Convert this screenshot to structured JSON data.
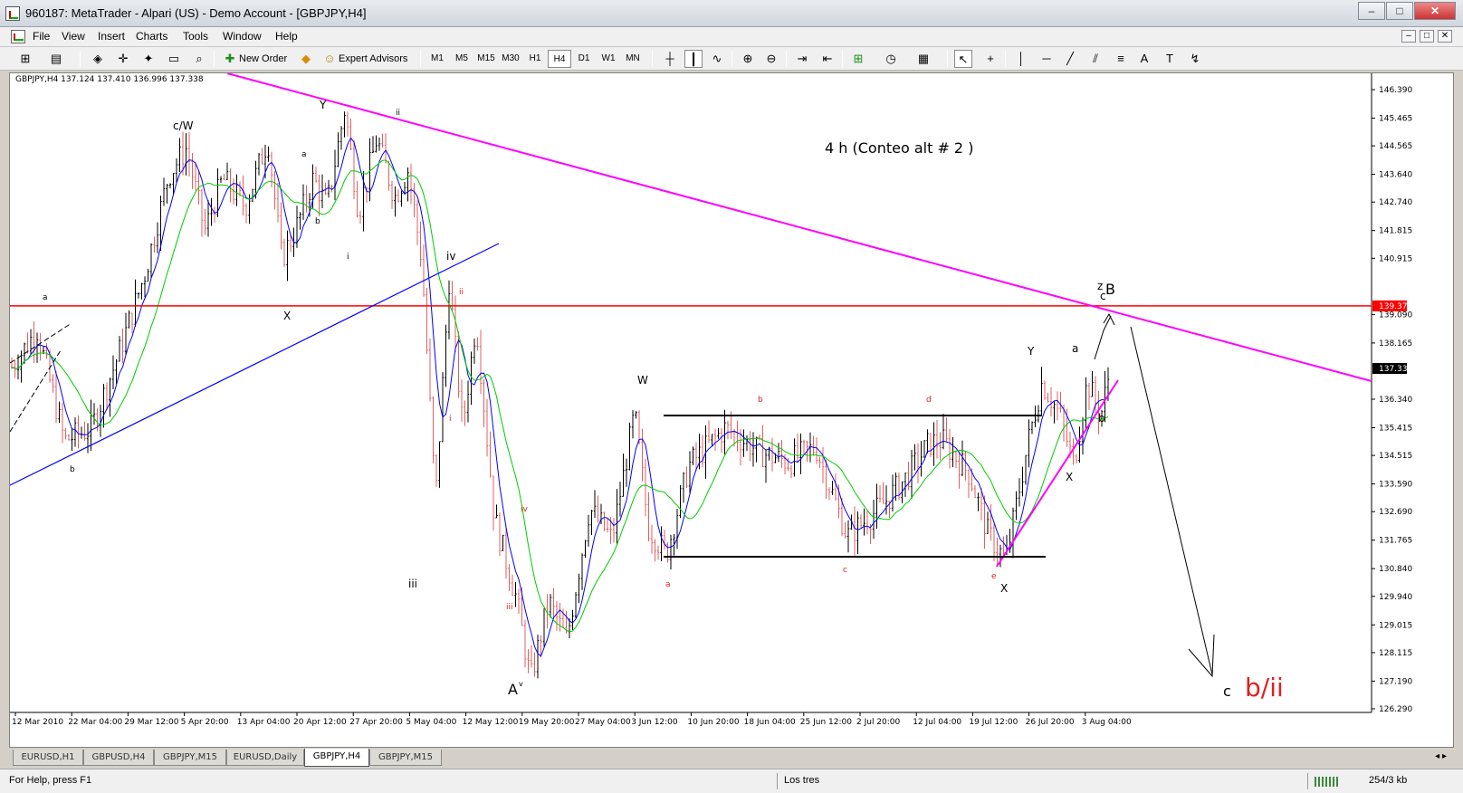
{
  "window": {
    "title": "960187: MetaTrader - Alpari (US) - Demo Account - [GBPJPY,H4]",
    "minimize": "–",
    "maximize": "□",
    "close": "✕"
  },
  "menu": {
    "items": [
      "File",
      "View",
      "Insert",
      "Charts",
      "Tools",
      "Window",
      "Help"
    ],
    "mdi_controls": [
      "–",
      "□",
      "✕"
    ]
  },
  "toolbar": {
    "new_order": "New Order",
    "expert_advisors": "Expert Advisors",
    "timeframes": [
      "M1",
      "M5",
      "M15",
      "M30",
      "H1",
      "H4",
      "D1",
      "W1",
      "MN"
    ],
    "active_timeframe": "H4",
    "icons": [
      "new-chart-icon",
      "profiles-icon",
      "market-watch-icon",
      "crosshair-icon",
      "navigator-icon",
      "terminal-icon",
      "strategy-tester-icon",
      "new-order-icon",
      "autotrading-icon",
      "bar-chart-icon",
      "candlestick-icon",
      "line-chart-icon",
      "zoom-in-icon",
      "zoom-out-icon",
      "chart-shift-icon",
      "autoscroll-icon",
      "indicators-icon",
      "periods-icon",
      "templates-icon",
      "cursor-icon",
      "crosshair-tool-icon",
      "vertical-line-icon",
      "horizontal-line-icon",
      "trendline-icon",
      "equidistant-channel-icon",
      "fibonacci-icon",
      "text-icon",
      "text-label-icon",
      "arrows-icon"
    ]
  },
  "chart": {
    "info": "GBPJPY,H4  137.124 137.410 136.996 137.338",
    "heading": "4 h (Conteo alt # 2 )",
    "price_axis": [
      "146.390",
      "145.465",
      "144.565",
      "143.640",
      "142.740",
      "141.815",
      "140.915",
      "139.090",
      "138.165",
      "136.340",
      "135.415",
      "134.515",
      "133.590",
      "132.690",
      "131.765",
      "130.840",
      "129.940",
      "129.015",
      "128.115",
      "127.190",
      "126.290"
    ],
    "red_line_price": "139.370",
    "last_price": "137.338",
    "time_axis": [
      "12 Mar 2010",
      "22 Mar 04:00",
      "29 Mar 12:00",
      "5 Apr 20:00",
      "13 Apr 04:00",
      "20 Apr 12:00",
      "27 Apr 20:00",
      "5 May 04:00",
      "12 May 12:00",
      "19 May 20:00",
      "27 May 04:00",
      "3 Jun 12:00",
      "10 Jun 20:00",
      "18 Jun 04:00",
      "25 Jun 12:00",
      "2 Jul 20:00",
      "12 Jul 04:00",
      "19 Jul 12:00",
      "26 Jul 20:00",
      "3 Aug 04:00"
    ],
    "colors": {
      "bull": "#000000",
      "bear": "#e06060",
      "ma_fast": "#0000ff",
      "ma_slow": "#00cc00",
      "resistance": "#ff00ff",
      "support_blue": "#0000ff",
      "horizontal_red": "#ff0000",
      "box": "#000000"
    },
    "wave_labels": {
      "black": [
        "c/W",
        "Y",
        "ii",
        "a",
        "b",
        "i",
        "iv",
        "X",
        "a",
        "b",
        "iii",
        "W",
        "Y",
        "a",
        "X",
        "X",
        "b",
        "c",
        "z"
      ],
      "red": [
        "ii",
        "i",
        "iv",
        "iii",
        "b",
        "d",
        "a",
        "c",
        "e"
      ],
      "large_black": [
        "A",
        "v",
        "B",
        "c"
      ],
      "large_red": "b/ii"
    }
  },
  "tabs": [
    "EURUSD,H1",
    "GBPUSD,H4",
    "GBPJPY,M15",
    "EURUSD,Daily",
    "GBPJPY,H4",
    "GBPJPY,M15"
  ],
  "active_tab": "GBPJPY,H4",
  "status": {
    "help": "For Help, press F1",
    "profile": "Los tres",
    "traffic": "254/3 kb"
  }
}
